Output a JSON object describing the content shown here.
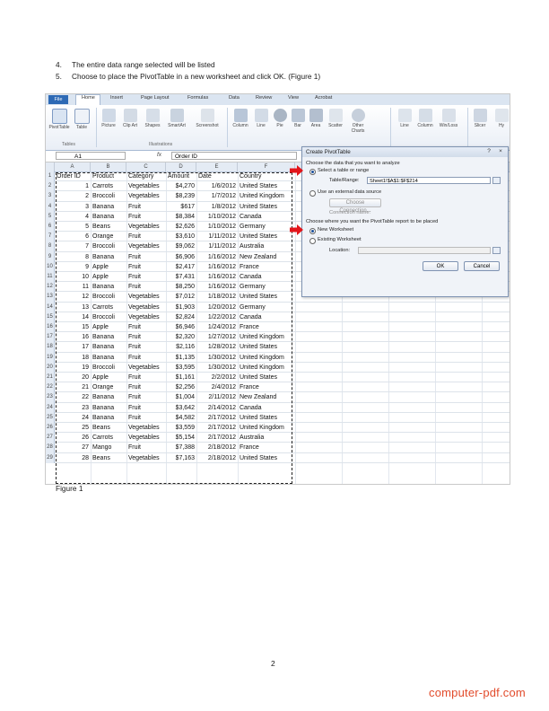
{
  "instructions": [
    {
      "number": "4.",
      "text": "The entire data range selected will be listed"
    },
    {
      "number": "5.",
      "text": "Choose to place the PivotTable in a new worksheet and click OK. (Figure 1)"
    }
  ],
  "excel": {
    "tabs": [
      "File",
      "Home",
      "Insert",
      "Page Layout",
      "Formulas",
      "Data",
      "Review",
      "View",
      "Acrobat"
    ],
    "ribbon": {
      "buttons": [
        "PivotTable",
        "Table",
        "Picture",
        "Clip Art",
        "Shapes",
        "SmartArt",
        "Screenshot",
        "Column",
        "Line",
        "Pie",
        "Bar",
        "Area",
        "Scatter",
        "Other Charts",
        "Line",
        "Column",
        "Win/Loss",
        "Slicer",
        "Hy"
      ],
      "groups": [
        "Tables",
        "Illustrations"
      ]
    },
    "name_box": "A1",
    "fx_symbol": "fx",
    "formula": "Order ID",
    "columns": [
      "A",
      "B",
      "C",
      "D",
      "E",
      "F"
    ],
    "headers": [
      "Order ID",
      "Product",
      "Category",
      "Amount",
      "Date",
      "Country"
    ],
    "rows": [
      [
        "1",
        "Carrots",
        "Vegetables",
        "$4,270",
        "1/6/2012",
        "United States"
      ],
      [
        "2",
        "Broccoli",
        "Vegetables",
        "$8,239",
        "1/7/2012",
        "United Kingdom"
      ],
      [
        "3",
        "Banana",
        "Fruit",
        "$617",
        "1/8/2012",
        "United States"
      ],
      [
        "4",
        "Banana",
        "Fruit",
        "$8,384",
        "1/10/2012",
        "Canada"
      ],
      [
        "5",
        "Beans",
        "Vegetables",
        "$2,626",
        "1/10/2012",
        "Germany"
      ],
      [
        "6",
        "Orange",
        "Fruit",
        "$3,610",
        "1/11/2012",
        "United States"
      ],
      [
        "7",
        "Broccoli",
        "Vegetables",
        "$9,062",
        "1/11/2012",
        "Australia"
      ],
      [
        "8",
        "Banana",
        "Fruit",
        "$6,906",
        "1/16/2012",
        "New Zealand"
      ],
      [
        "9",
        "Apple",
        "Fruit",
        "$2,417",
        "1/16/2012",
        "France"
      ],
      [
        "10",
        "Apple",
        "Fruit",
        "$7,431",
        "1/16/2012",
        "Canada"
      ],
      [
        "11",
        "Banana",
        "Fruit",
        "$8,250",
        "1/16/2012",
        "Germany"
      ],
      [
        "12",
        "Broccoli",
        "Vegetables",
        "$7,012",
        "1/18/2012",
        "United States"
      ],
      [
        "13",
        "Carrots",
        "Vegetables",
        "$1,903",
        "1/20/2012",
        "Germany"
      ],
      [
        "14",
        "Broccoli",
        "Vegetables",
        "$2,824",
        "1/22/2012",
        "Canada"
      ],
      [
        "15",
        "Apple",
        "Fruit",
        "$6,946",
        "1/24/2012",
        "France"
      ],
      [
        "16",
        "Banana",
        "Fruit",
        "$2,320",
        "1/27/2012",
        "United Kingdom"
      ],
      [
        "17",
        "Banana",
        "Fruit",
        "$2,116",
        "1/28/2012",
        "United States"
      ],
      [
        "18",
        "Banana",
        "Fruit",
        "$1,135",
        "1/30/2012",
        "United Kingdom"
      ],
      [
        "19",
        "Broccoli",
        "Vegetables",
        "$3,595",
        "1/30/2012",
        "United Kingdom"
      ],
      [
        "20",
        "Apple",
        "Fruit",
        "$1,161",
        "2/2/2012",
        "United States"
      ],
      [
        "21",
        "Orange",
        "Fruit",
        "$2,256",
        "2/4/2012",
        "France"
      ],
      [
        "22",
        "Banana",
        "Fruit",
        "$1,004",
        "2/11/2012",
        "New Zealand"
      ],
      [
        "23",
        "Banana",
        "Fruit",
        "$3,642",
        "2/14/2012",
        "Canada"
      ],
      [
        "24",
        "Banana",
        "Fruit",
        "$4,582",
        "2/17/2012",
        "United States"
      ],
      [
        "25",
        "Beans",
        "Vegetables",
        "$3,559",
        "2/17/2012",
        "United Kingdom"
      ],
      [
        "26",
        "Carrots",
        "Vegetables",
        "$5,154",
        "2/17/2012",
        "Australia"
      ],
      [
        "27",
        "Mango",
        "Fruit",
        "$7,388",
        "2/18/2012",
        "France"
      ],
      [
        "28",
        "Beans",
        "Vegetables",
        "$7,163",
        "2/18/2012",
        "United States"
      ]
    ],
    "dialog": {
      "title": "Create PivotTable",
      "section1": "Choose the data that you want to analyze",
      "opt_select_table": "Select a table or range",
      "table_range_label": "Table/Range:",
      "table_range_value": "Sheet1!$A$1:$F$214",
      "opt_external": "Use an external data source",
      "choose_connection": "Choose Connection...",
      "connection_name": "Connection name:",
      "section2": "Choose where you want the PivotTable report to be placed",
      "opt_new_ws": "New Worksheet",
      "opt_existing_ws": "Existing Worksheet",
      "location_label": "Location:",
      "ok": "OK",
      "cancel": "Cancel",
      "help_icon": "?",
      "close_icon": "×"
    }
  },
  "caption": "Figure 1",
  "page_number": "2",
  "watermark": "computer-pdf.com"
}
